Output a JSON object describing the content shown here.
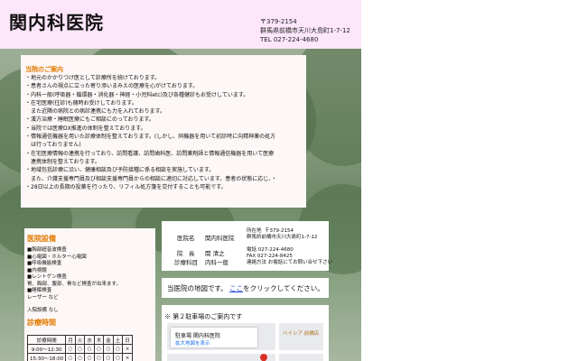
{
  "header": {
    "clinic_name": "関内科医院",
    "postal": "〒379-2154",
    "address": "群馬県前橋市天川大島町1-7-12",
    "tel": "TEL 027-224-4680"
  },
  "notice": {
    "title": "当院のご案内",
    "lines": [
      "・地元のかかりつけ医として診療所を続けております。",
      "・患者さんの視点に立った寄り添いまみえの医療を心がけております。",
      "・内科一般(呼吸器・循環器・消化器・神経・小児科etc)及び各種健診もお受けしています。",
      "・在宅医療(往診)も随時お受けしております。",
      "　また近隣の病院との病診連携にも力を入れております。",
      "・漢方治療・睡眠医療にもご相談にのっております。",
      "・当院では医療DX推進の体制を整えております。",
      "・情報通信機器を用いた診療体制を整えております。(しかし、同機器を用いて初診時に向精神薬の処方",
      "　は行っておりません)",
      "・在宅医療情報の連携を行っており、訪問看護、訪問歯科医、訪問薬剤師と情報通信機器を用いて医療",
      "　連携体制を整えております。",
      "・地域包括診療に沿い、健康相談及び予防接種に係る相談を実施しています。",
      "　また、介護支援専門員及び相談支援専門員からの相談に適切に対応しています。患者の状態に応じ、・",
      "・28日以上の長期の投薬を行ったり、リフィル処方箋を交付することも可能です。"
    ]
  },
  "facilities": {
    "heading": "医院設備",
    "items": [
      "■胸部超音波検査",
      "■心電図・ホルター心電図",
      "■呼吸機能検査",
      "■内視鏡",
      "■レントゲン検査",
      "胃、胸部、腹部、骨など検査が出来ます。",
      "■睡眠検査",
      "レーザー など"
    ],
    "inpatient": "入院設備 なし"
  },
  "hours": {
    "heading": "診療時間",
    "header_row": [
      "診療時間",
      "月",
      "火",
      "水",
      "木",
      "金",
      "土",
      "日"
    ],
    "rows": [
      [
        "9:00〜12:30",
        "○",
        "○",
        "○",
        "○",
        "○",
        "○",
        "×"
      ],
      [
        "15:30〜18:00",
        "○",
        "○",
        "○",
        "○",
        "○",
        "○",
        "×"
      ]
    ]
  },
  "info": {
    "name_label": "医院名",
    "name_value": "関内科医院",
    "location_label": "所在地",
    "location_postal": "〒379-2154",
    "location_address": "群馬県前橋市天川大島町1-7-12",
    "director_label": "院　長",
    "director_value": "関 清之",
    "tel": "電話 027-224-4680",
    "dept_label": "診療科目",
    "dept_value": "内科一般",
    "fax": "FAX 027-224-8425",
    "contact": "連絡方法 お電話にてお問い合せ下さい"
  },
  "map_link": {
    "prefix": "当医院の地図です。",
    "link": "ここ",
    "suffix": "をクリックしてください。"
  },
  "parking": {
    "title": "※ 第２駐車場のご案内です",
    "card_title": "駐車場 関内科医院",
    "card_link": "拡大地図を表示",
    "poi": "ベイシア 前橋店"
  },
  "colors": {
    "header_bg": "#fde6fa",
    "accent": "#e07a00",
    "link": "#1a3fd0"
  }
}
